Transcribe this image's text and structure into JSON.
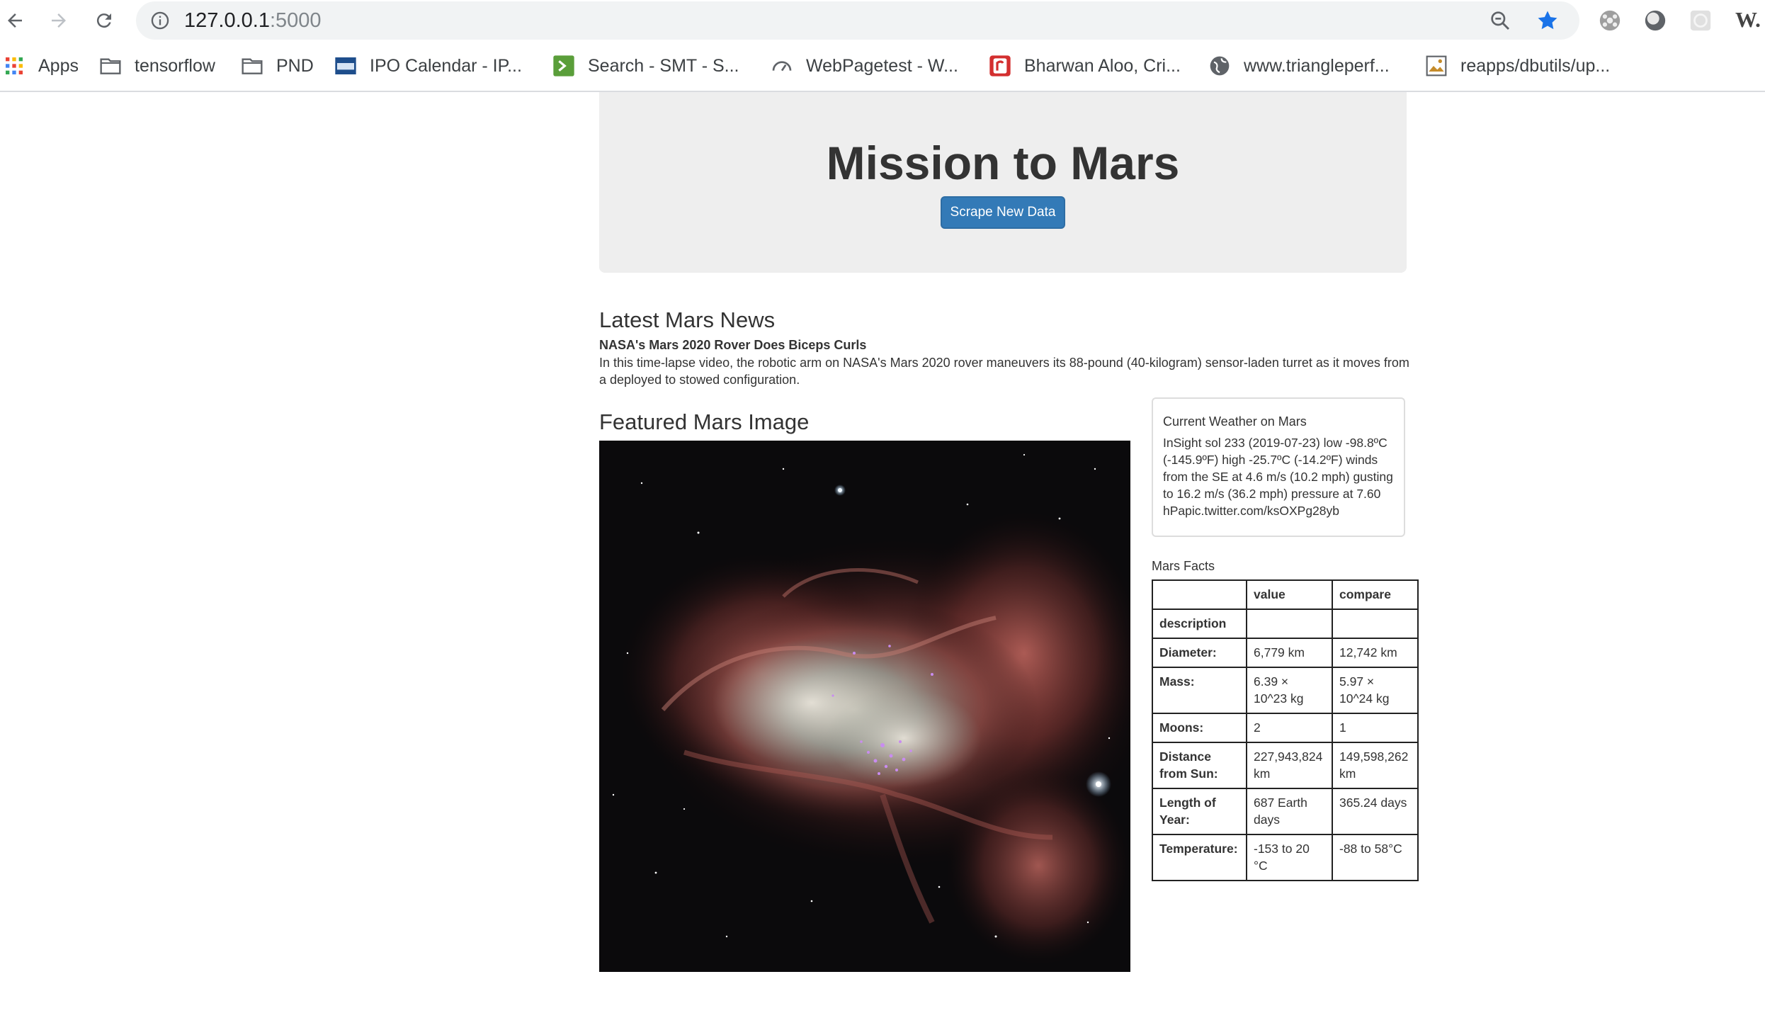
{
  "browser": {
    "url_host": "127.0.0.1",
    "url_port": ":5000",
    "bookmarks": [
      {
        "label": "Apps",
        "icon": "apps-grid-icon"
      },
      {
        "label": "tensorflow",
        "icon": "folder-icon"
      },
      {
        "label": "PND",
        "icon": "folder-icon"
      },
      {
        "label": "IPO Calendar - IP...",
        "icon": "ipo-icon"
      },
      {
        "label": "Search - SMT - S...",
        "icon": "terminal-icon"
      },
      {
        "label": "WebPagetest - W...",
        "icon": "speedometer-icon"
      },
      {
        "label": "Bharwan Aloo, Cri...",
        "icon": "recipe-icon"
      },
      {
        "label": "www.triangleperf...",
        "icon": "globe-icon"
      },
      {
        "label": "reapps/dbutils/up...",
        "icon": "image-icon"
      }
    ],
    "extension_label": "W."
  },
  "jumbotron": {
    "title": "Mission to Mars",
    "button_label": "Scrape New Data",
    "button_color": "#337ab7"
  },
  "news": {
    "heading": "Latest Mars News",
    "title": "NASA's Mars 2020 Rover Does Biceps Curls",
    "body": "In this time-lapse video, the robotic arm on NASA's Mars 2020 rover maneuvers its 88-pound (40-kilogram) sensor-laden turret as it moves from a deployed to stowed configuration."
  },
  "featured": {
    "heading": "Featured Mars Image"
  },
  "weather": {
    "title": "Current Weather on Mars",
    "text": "InSight sol 233 (2019-07-23) low -98.8ºC (-145.9ºF) high -25.7ºC (-14.2ºF) winds from the SE at 4.6 m/s (10.2 mph) gusting to 16.2 m/s (36.2 mph) pressure at 7.60 hPapic.twitter.com/ksOXPg28yb"
  },
  "facts": {
    "label": "Mars Facts",
    "headers": [
      "",
      "value",
      "compare"
    ],
    "rows": [
      [
        "description",
        "",
        ""
      ],
      [
        "Diameter:",
        "6,779 km",
        "12,742 km"
      ],
      [
        "Mass:",
        "6.39 × 10^23 kg",
        "5.97 × 10^24 kg"
      ],
      [
        "Moons:",
        "2",
        "1"
      ],
      [
        "Distance from Sun:",
        "227,943,824 km",
        "149,598,262 km"
      ],
      [
        "Length of Year:",
        "687 Earth days",
        "365.24 days"
      ],
      [
        "Temperature:",
        "-153 to 20 °C",
        "-88 to 58°C"
      ]
    ]
  }
}
